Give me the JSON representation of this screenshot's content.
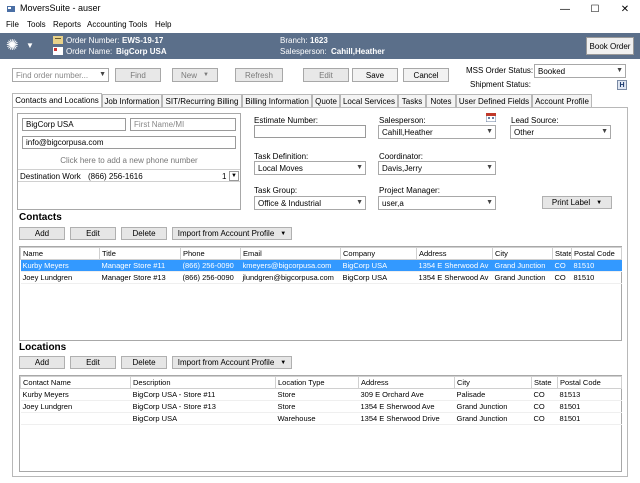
{
  "window": {
    "title": "MoversSuite - auser",
    "min": "—",
    "max": "☐",
    "close": "✕"
  },
  "menu": [
    "File",
    "Tools",
    "Reports",
    "Accounting Tools",
    "Help"
  ],
  "header": {
    "order_number_label": "Order Number:",
    "order_number": "EWS-19-17",
    "order_name_label": "Order Name:",
    "order_name": "BigCorp USA",
    "branch_label": "Branch:",
    "branch": "1623",
    "salesperson_label": "Salesperson:",
    "salesperson": "Cahill,Heather",
    "book_order": "Book Order"
  },
  "toolbar": {
    "find_placeholder": "Find order number...",
    "find": "Find",
    "new": "New",
    "refresh": "Refresh",
    "edit": "Edit",
    "save": "Save",
    "cancel": "Cancel",
    "mss_label": "MSS Order Status:",
    "mss_value": "Booked",
    "shipment_label": "Shipment Status:",
    "shipment_icon": "H"
  },
  "tabs": [
    "Contacts and Locations",
    "Job Information",
    "SIT/Recurring Billing",
    "Billing Information",
    "Quote",
    "Local Services",
    "Tasks",
    "Notes",
    "User Defined Fields",
    "Account Profile"
  ],
  "contact_card": {
    "company": "BigCorp USA",
    "first_name_placeholder": "First Name/MI",
    "email": "info@bigcorpusa.com",
    "add_phone": "Click here to add a new phone number",
    "phone_type": "Destination Work",
    "phone": "(866) 256-1616",
    "phone_idx": "1"
  },
  "form": {
    "estimate_number_label": "Estimate Number:",
    "estimate_number": "",
    "salesperson_label": "Salesperson:",
    "salesperson": "Cahill,Heather",
    "lead_source_label": "Lead Source:",
    "lead_source": "Other",
    "task_definition_label": "Task Definition:",
    "task_definition": "Local Moves",
    "coordinator_label": "Coordinator:",
    "coordinator": "Davis,Jerry",
    "task_group_label": "Task Group:",
    "task_group": "Office & Industrial",
    "project_manager_label": "Project Manager:",
    "project_manager": "user,a",
    "print_label": "Print Label"
  },
  "contacts": {
    "title": "Contacts",
    "add": "Add",
    "edit": "Edit",
    "delete": "Delete",
    "import": "Import from Account Profile",
    "columns": [
      "Name",
      "Title",
      "Phone",
      "Email",
      "Company",
      "Address",
      "City",
      "State",
      "Postal Code"
    ],
    "rows": [
      [
        "Kurby Meyers",
        "Manager Store #11",
        "(866) 256-0090",
        "kmeyers@bigcorpusa.com",
        "BigCorp USA",
        "1354 E Sherwood Av",
        "Grand Junction",
        "CO",
        "81510"
      ],
      [
        "Joey Lundgren",
        "Manager Store #13",
        "(866) 256-0090",
        "jlundgren@bigcorpusa.com",
        "BigCorp USA",
        "1354 E Sherwood Av",
        "Grand Junction",
        "CO",
        "81510"
      ]
    ]
  },
  "locations": {
    "title": "Locations",
    "add": "Add",
    "edit": "Edit",
    "delete": "Delete",
    "import": "Import from Account Profile",
    "columns": [
      "Contact Name",
      "Description",
      "Location Type",
      "Address",
      "City",
      "State",
      "Postal Code"
    ],
    "rows": [
      [
        "Kurby Meyers",
        "BigCorp USA - Store #11",
        "Store",
        "309 E Orchard Ave",
        "Palisade",
        "CO",
        "81513"
      ],
      [
        "Joey Lundgren",
        "BigCorp USA - Store #13",
        "Store",
        "1354 E Sherwood Ave",
        "Grand Junction",
        "CO",
        "81501"
      ],
      [
        "",
        "BigCorp USA",
        "Warehouse",
        "1354 E Sherwood Drive",
        "Grand Junction",
        "CO",
        "81501"
      ]
    ]
  },
  "colors": {
    "header_bg": "#5b6f8a",
    "selection": "#3399ff"
  }
}
